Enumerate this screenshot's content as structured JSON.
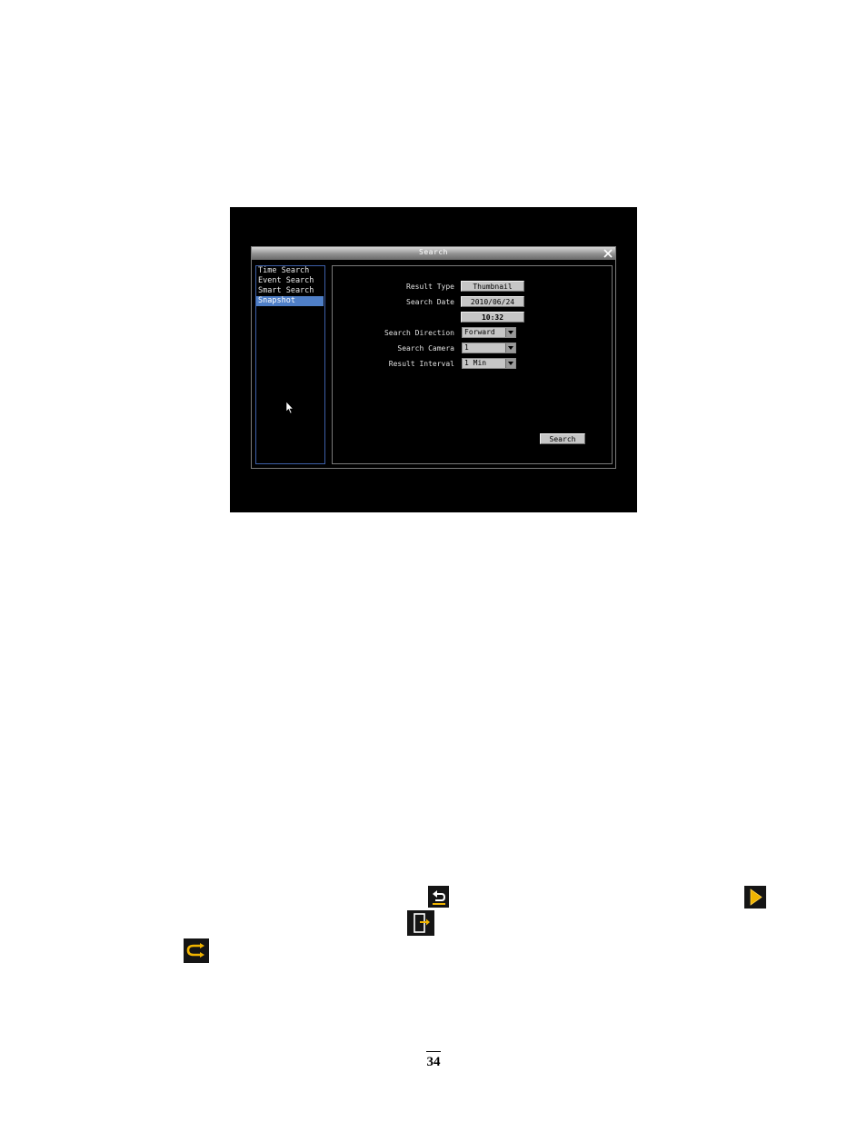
{
  "dialog": {
    "title": "Search",
    "sidebar": {
      "items": [
        {
          "label": "Time Search",
          "selected": false
        },
        {
          "label": "Event Search",
          "selected": false
        },
        {
          "label": "Smart Search",
          "selected": false
        },
        {
          "label": "Snapshot",
          "selected": true
        }
      ]
    },
    "form": {
      "result_type_label": "Result Type",
      "result_type_value": "Thumbnail",
      "search_date_label": "Search Date",
      "search_date_value": "2010/06/24",
      "search_time_value": "10:32",
      "search_direction_label": "Search Direction",
      "search_direction_value": "Forward",
      "search_camera_label": "Search Camera",
      "search_camera_value": "1",
      "result_interval_label": "Result Interval",
      "result_interval_value": "1 Min",
      "search_button": "Search"
    }
  },
  "icons": {
    "back": "back-arrow-icon",
    "play": "play-icon",
    "exit": "exit-door-icon",
    "return": "return-arrow-icon"
  },
  "colors": {
    "screen_bg": "#000000",
    "selection": "#4f7fc7",
    "sidebar_border": "#3d5fa8",
    "icon_accent": "#f0b400"
  },
  "page": {
    "number": "34"
  }
}
